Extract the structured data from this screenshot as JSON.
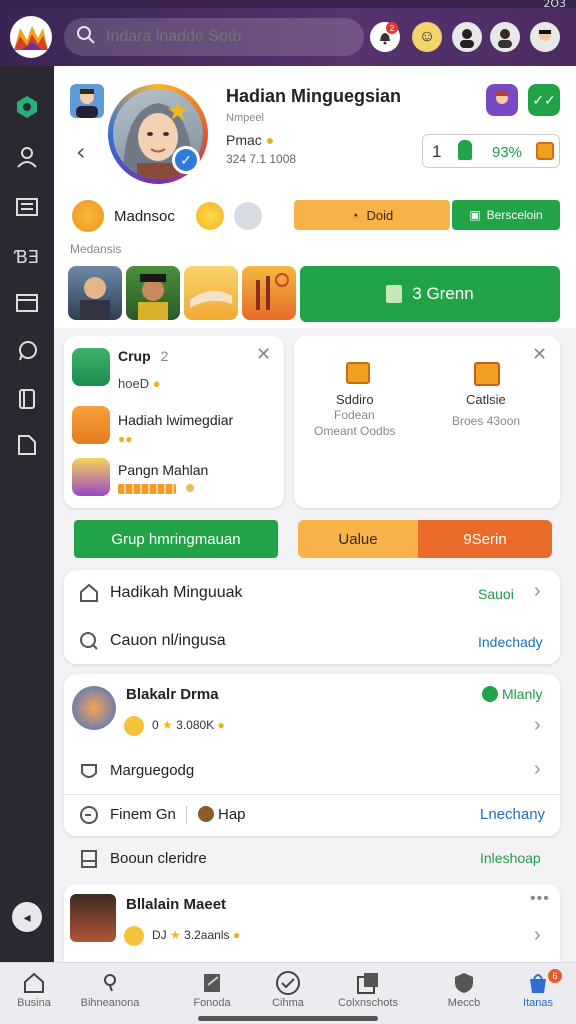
{
  "status": {
    "time": "2O3"
  },
  "topbar": {
    "search_placeholder": "Indara lnadde Sotb",
    "notif_badge": "2"
  },
  "profile": {
    "name": "Hadian Minguegsian",
    "subtitle": "Nmpeel",
    "line1": "Pmac",
    "line2": "324 7.1 1008",
    "stat_num": "1",
    "stat_pct": "93%"
  },
  "row2": {
    "label": "Madnsoc",
    "sub_label": "Medansis",
    "btn_dold": "Doid",
    "btn_berscelin": "Bersceloin"
  },
  "media": {
    "green_btn": "3 Grenn"
  },
  "group_card": {
    "title": "Crup",
    "title_num": "2",
    "sub": "hoeD",
    "item1": "Hadiah lwimegdiar",
    "item2": "Pangn Mahlan"
  },
  "right_card": {
    "col1_title": "Sddiro",
    "col1_line1": "Fodean",
    "col1_line2": "Omeant Oodbs",
    "col2_title": "Catlsie",
    "col2_line1": "Broes 43oon"
  },
  "actions": {
    "green_btn": "Grup hmringmauan",
    "value_btn": "Ualue",
    "serin_btn": "9Serin"
  },
  "list1": {
    "row1_label": "Hadikah Minguuak",
    "row1_action": "Sauoi",
    "row2_label": "Cauon nl/ingusa",
    "row2_action": "Indechady"
  },
  "card2": {
    "title": "Blakalr Drma",
    "badge": "Mlanly",
    "meta_num": "0",
    "meta_val": "3.080K",
    "row_label": "Marguegodg",
    "bottom_left": "Finem Gn",
    "bottom_mid": "Hap",
    "bottom_action": "Lnechany"
  },
  "bookmark_row": {
    "label": "Booun cleridre",
    "action": "Inleshoap"
  },
  "card3": {
    "title": "Bllalain Maeet",
    "meta_num": "DJ",
    "meta_val": "3.2aanls"
  },
  "bottom_nav": [
    {
      "label": "Busina",
      "icon": "home-icon"
    },
    {
      "label": "Bihneanona",
      "icon": "user-icon"
    },
    {
      "label": "Fonoda",
      "icon": "note-icon"
    },
    {
      "label": "Cihma",
      "icon": "check-icon"
    },
    {
      "label": "Colxnschots",
      "icon": "collection-icon"
    },
    {
      "label": "Meccb",
      "icon": "shield-icon"
    },
    {
      "label": "Itanas",
      "icon": "bag-icon",
      "badge": "6"
    }
  ],
  "colors": {
    "accent_green": "#21a347",
    "accent_orange": "#f7b24a",
    "top_purple": "#4a2c61"
  }
}
